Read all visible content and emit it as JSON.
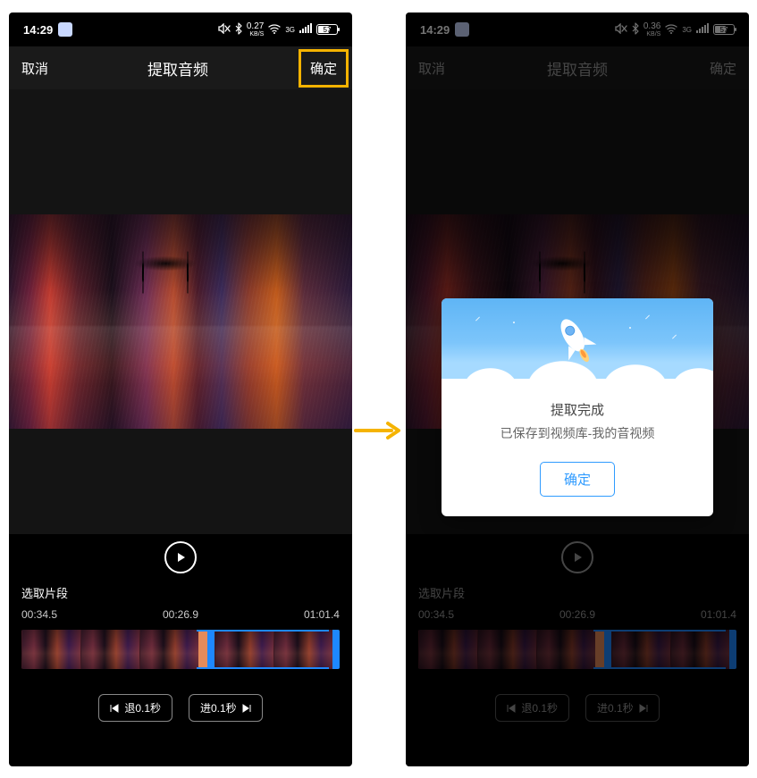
{
  "status_bar": {
    "time": "14:29",
    "net_speed_left": "0.27",
    "net_speed_right": "0.36",
    "net_unit": "KB/S",
    "signal": "3G",
    "battery_percent": "57"
  },
  "navbar": {
    "cancel": "取消",
    "title": "提取音频",
    "confirm": "确定"
  },
  "editor": {
    "section_label": "选取片段",
    "time_start": "00:34.5",
    "time_cursor": "00:26.9",
    "time_end": "01:01.4",
    "step_back_label": "退0.1秒",
    "step_fwd_label": "进0.1秒"
  },
  "dialog": {
    "title": "提取完成",
    "subtitle": "已保存到视频库-我的音视频",
    "confirm": "确定"
  }
}
